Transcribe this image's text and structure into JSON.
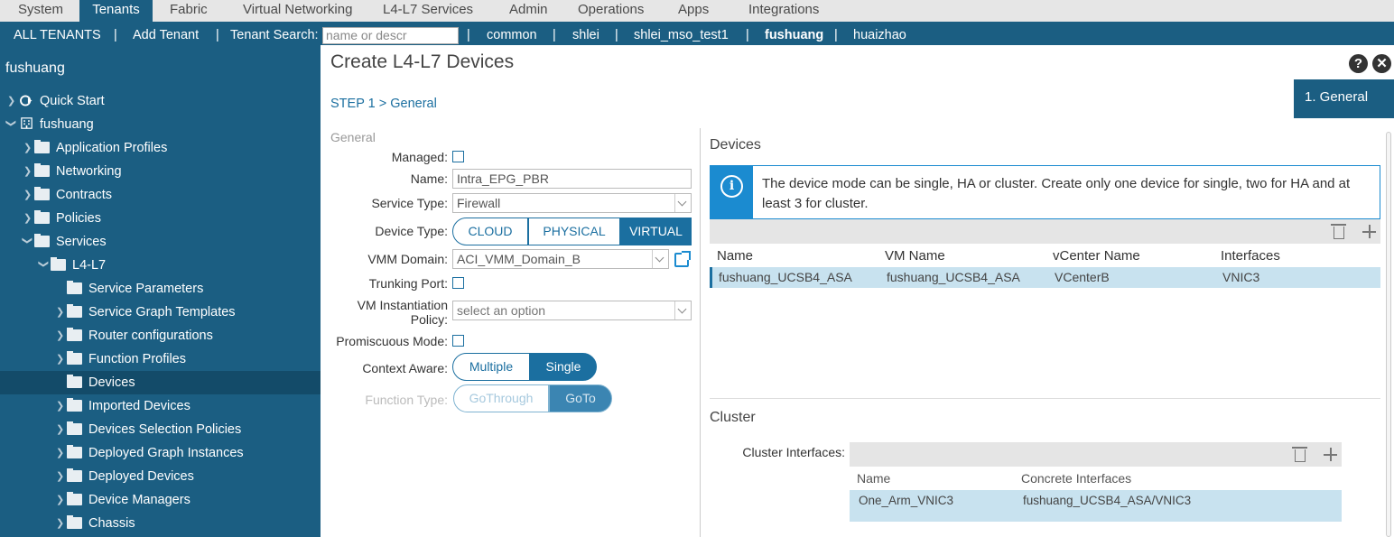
{
  "top_tabs": [
    {
      "label": "System"
    },
    {
      "label": "Tenants"
    },
    {
      "label": "Fabric"
    },
    {
      "label": "Virtual Networking"
    },
    {
      "label": "L4-L7 Services"
    },
    {
      "label": "Admin"
    },
    {
      "label": "Operations"
    },
    {
      "label": "Apps"
    },
    {
      "label": "Integrations"
    }
  ],
  "sub_nav": {
    "all_tenants": "ALL TENANTS",
    "sep": "|",
    "add_tenant": "Add Tenant",
    "search_label": "Tenant Search:",
    "search_placeholder": "name or descr",
    "tenants": [
      "common",
      "shlei",
      "shlei_mso_test1",
      "fushuang",
      "huaizhao"
    ]
  },
  "sidebar": {
    "tenant_title": "fushuang",
    "items": [
      {
        "label": "Quick Start"
      },
      {
        "label": "fushuang"
      },
      {
        "label": "Application Profiles"
      },
      {
        "label": "Networking"
      },
      {
        "label": "Contracts"
      },
      {
        "label": "Policies"
      },
      {
        "label": "Services"
      },
      {
        "label": "L4-L7"
      },
      {
        "label": "Service Parameters"
      },
      {
        "label": "Service Graph Templates"
      },
      {
        "label": "Router configurations"
      },
      {
        "label": "Function Profiles"
      },
      {
        "label": "Devices"
      },
      {
        "label": "Imported Devices"
      },
      {
        "label": "Devices Selection Policies"
      },
      {
        "label": "Deployed Graph Instances"
      },
      {
        "label": "Deployed Devices"
      },
      {
        "label": "Device Managers"
      },
      {
        "label": "Chassis"
      }
    ]
  },
  "dialog": {
    "title": "Create L4-L7 Devices",
    "help": "?",
    "close": "✕",
    "step": "STEP 1 > General",
    "step_tab": "1. General"
  },
  "form": {
    "section": "General",
    "managed_label": "Managed:",
    "name_label": "Name:",
    "name_value": "Intra_EPG_PBR",
    "service_type_label": "Service Type:",
    "service_type_value": "Firewall",
    "device_type_label": "Device Type:",
    "device_type_options": [
      "CLOUD",
      "PHYSICAL",
      "VIRTUAL"
    ],
    "vmm_domain_label": "VMM Domain:",
    "vmm_domain_value": "ACI_VMM_Domain_B",
    "trunking_label": "Trunking Port:",
    "vm_inst_label_1": "VM Instantiation",
    "vm_inst_label_2": "Policy:",
    "vm_inst_value": "select an option",
    "promiscuous_label": "Promiscuous Mode:",
    "context_aware_label": "Context Aware:",
    "context_aware_options": [
      "Multiple",
      "Single"
    ],
    "function_type_label": "Function Type:",
    "function_type_options": [
      "GoThrough",
      "GoTo"
    ]
  },
  "devices": {
    "heading": "Devices",
    "info_icon": "i",
    "info_text": "The device mode can be single, HA or cluster. Create only one device for single, two for HA and at least 3 for cluster.",
    "columns": [
      "Name",
      "VM Name",
      "vCenter Name",
      "Interfaces"
    ],
    "rows": [
      {
        "name": "fushuang_UCSB4_ASA",
        "vm_name": "fushuang_UCSB4_ASA",
        "vcenter": "VCenterB",
        "interfaces": "VNIC3"
      }
    ]
  },
  "cluster": {
    "heading": "Cluster",
    "interfaces_label": "Cluster Interfaces:",
    "columns": [
      "Name",
      "Concrete Interfaces"
    ],
    "rows": [
      {
        "name": "One_Arm_VNIC3",
        "concrete": "fushuang_UCSB4_ASA/VNIC3"
      }
    ]
  },
  "colors": {
    "brand": "#1b5e82",
    "accent": "#1b6fa0",
    "selection": "#c8e2ef"
  }
}
